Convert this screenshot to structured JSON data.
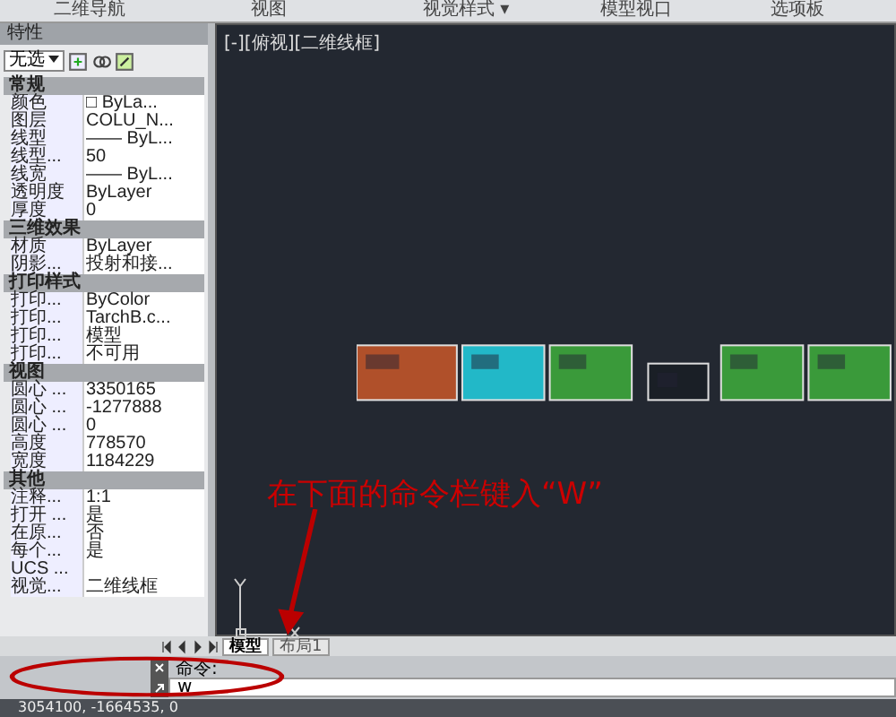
{
  "ribbon": {
    "groups": [
      "二维导航",
      "视图",
      "视觉样式 ▾",
      "模型视口",
      "选项板"
    ]
  },
  "properties": {
    "title": "特性",
    "selection": "无选",
    "sections": [
      {
        "title": "常规",
        "rows": [
          {
            "label": "颜色",
            "value": "□ ByLa..."
          },
          {
            "label": "图层",
            "value": "COLU_N..."
          },
          {
            "label": "线型",
            "value": "—— ByL..."
          },
          {
            "label": "线型...",
            "value": "50"
          },
          {
            "label": "线宽",
            "value": "—— ByL..."
          },
          {
            "label": "透明度",
            "value": "ByLayer"
          },
          {
            "label": "厚度",
            "value": "0"
          }
        ]
      },
      {
        "title": "三维效果",
        "rows": [
          {
            "label": "材质",
            "value": "ByLayer"
          },
          {
            "label": "阴影...",
            "value": "投射和接..."
          }
        ]
      },
      {
        "title": "打印样式",
        "rows": [
          {
            "label": "打印...",
            "value": "ByColor"
          },
          {
            "label": "打印...",
            "value": "TarchB.c..."
          },
          {
            "label": "打印...",
            "value": "模型"
          },
          {
            "label": "打印...",
            "value": "不可用"
          }
        ]
      },
      {
        "title": "视图",
        "rows": [
          {
            "label": "圆心 ...",
            "value": "3350165"
          },
          {
            "label": "圆心 ...",
            "value": "-1277888"
          },
          {
            "label": "圆心 ...",
            "value": "0"
          },
          {
            "label": "高度",
            "value": "778570"
          },
          {
            "label": "宽度",
            "value": "1184229"
          }
        ]
      },
      {
        "title": "其他",
        "rows": [
          {
            "label": "注释...",
            "value": "1:1"
          },
          {
            "label": "打开 ...",
            "value": "是"
          },
          {
            "label": "在原...",
            "value": "否"
          },
          {
            "label": "每个...",
            "value": "是"
          },
          {
            "label": "UCS ..."
          },
          {
            "label": "视觉...",
            "value": "二维线框"
          }
        ]
      }
    ]
  },
  "viewport": {
    "label": "[-][俯视][二维线框]",
    "annotation": "在下面的命令栏键入“W”"
  },
  "layout_tabs": [
    {
      "label": "模型",
      "selected": true
    },
    {
      "label": "布局1",
      "selected": false
    }
  ],
  "command": {
    "history": "命令:",
    "input": "w"
  },
  "status_bar": {
    "coordinates": "3054100, -1664535, 0"
  }
}
